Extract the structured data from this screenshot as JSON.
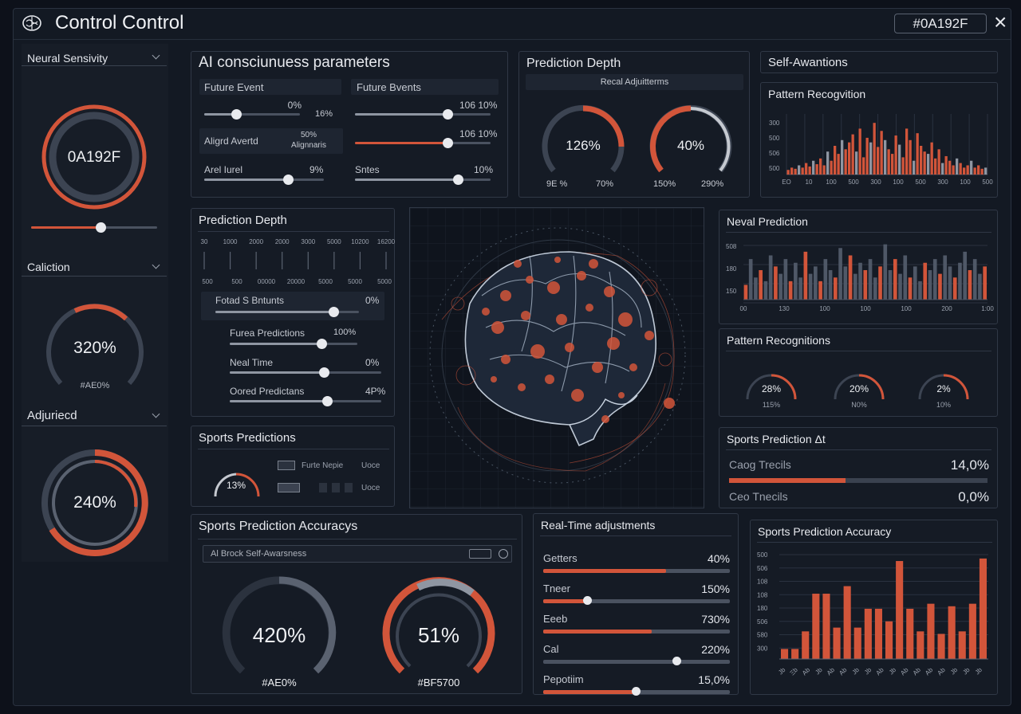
{
  "window": {
    "title": "Control Control",
    "id_badge": "#0A192F",
    "close_label": "×"
  },
  "colors": {
    "accent": "#d2553a",
    "panel": "#151b25",
    "track": "#4a5260"
  },
  "left": {
    "neural": {
      "title": "Neural Sensivity",
      "center": "0A192F",
      "ring": 0.75,
      "slider": 0.5
    },
    "calib": {
      "title": "Caliction",
      "value": "320%",
      "sub": "#AE0%",
      "arc": 0.3
    },
    "adjusted": {
      "title": "Adjuriecd",
      "value": "240%",
      "arc": 0.6
    }
  },
  "consc": {
    "title": "AI consciunuess parameters",
    "head_left": "Future Event",
    "head_right": "Future Bvents",
    "left": [
      {
        "label": "",
        "value": "0%",
        "slider": 0.3
      },
      {
        "label": "",
        "value": "16%",
        "slider": null
      },
      {
        "label": "Aligrd Avertd",
        "value": "50%\nAlignnaris",
        "slider": null
      },
      {
        "label": "Arel Iurel",
        "value": "9%",
        "slider": 0.73
      }
    ],
    "right": [
      {
        "label": "",
        "value": "106 10%",
        "slider": 0.68
      },
      {
        "label": "",
        "value": "106 10%",
        "slider": 0.68
      },
      {
        "label": "Sntes",
        "value": "10%",
        "slider": 0.7
      }
    ]
  },
  "pdepth_top": {
    "title": "Prediction Depth",
    "sub": "Recal Adjuitterms",
    "g1": {
      "value": "126%",
      "lo": "9E %",
      "hi": "70%",
      "arc": 0.55
    },
    "g2": {
      "value": "40%",
      "lo": "150%",
      "hi": "290%",
      "arc": 0.5
    }
  },
  "self": {
    "title": "Self-Awantions"
  },
  "pattern": {
    "title": "Pattern Recogvition",
    "y": [
      "300",
      "500",
      "506",
      "500"
    ],
    "x": [
      "ΕΟ",
      "10",
      "100",
      "500",
      "300",
      "100",
      "500",
      "300",
      "100",
      "500"
    ]
  },
  "pdepth_mid": {
    "title": "Prediction Depth",
    "top_ticks": [
      "30",
      "1000",
      "2000",
      "2000",
      "3000",
      "5000",
      "10200",
      "16200"
    ],
    "bot_ticks": [
      "500",
      "500",
      "00000",
      "20000",
      "5000",
      "5000",
      "5000"
    ],
    "rows": [
      {
        "label": "Fotad S Bntunts",
        "value": "0%",
        "slider": 0.72
      },
      {
        "label": "Furea Predictions",
        "value": "100%",
        "slider": 0.7
      },
      {
        "label": "Neal Time",
        "value": "0%",
        "slider": 0.75
      },
      {
        "label": "Oored Predictans",
        "value": "4P%",
        "slider": 0.8
      }
    ]
  },
  "sports_pred": {
    "title": "Sports Predictions",
    "gauge": "13%",
    "arc": 0.75,
    "items": [
      {
        "label": "Furte Nepie",
        "right": "Uoce"
      },
      {
        "label": "",
        "right": "Uoce"
      }
    ]
  },
  "neural_pred": {
    "title": "Neval Prediction",
    "y": [
      "508",
      "180",
      "150"
    ],
    "x": [
      "00",
      "130",
      "100",
      "100",
      "100",
      "200",
      "1:00"
    ]
  },
  "pattern2": {
    "title": "Pattern Recognitions",
    "g": [
      {
        "value": "28%",
        "sub": "115%",
        "arc": 0.45
      },
      {
        "value": "20%",
        "sub": "N0%",
        "arc": 0.4
      },
      {
        "value": "2%",
        "sub": "10%",
        "arc": 0.35
      }
    ]
  },
  "sports_pred_at": {
    "title": "Sports Prediction Δt",
    "rows": [
      {
        "label": "Caog Trecils",
        "value": "14,0%",
        "bar": 0.44
      },
      {
        "label": "Ceo Tnecils",
        "value": "0,0%",
        "bar": 0
      }
    ]
  },
  "accuracy_left": {
    "title": "Sports Prediction Accuracys",
    "search": "Al Brock Self-Awarsness",
    "g1": {
      "value": "420%",
      "sub": "#AE0%",
      "arc": 0.8
    },
    "g2": {
      "value": "51%",
      "sub": "#BF5700",
      "arc": 0.85
    }
  },
  "realtime": {
    "title": "Real-Time adjustments",
    "rows": [
      {
        "label": "Getters",
        "value": "40%",
        "bar": 0.66,
        "knob": null
      },
      {
        "label": "Tneer",
        "value": "150%",
        "bar": 0.24,
        "knob": 0.24
      },
      {
        "label": "Eeeb",
        "value": "730%",
        "bar": 0.58,
        "knob": null
      },
      {
        "label": "Cal",
        "value": "220%",
        "bar": 0.0,
        "knob": 0.72
      },
      {
        "label": "Pepotiim",
        "value": "15,0%",
        "bar": 0.5,
        "knob": 0.5
      }
    ]
  },
  "accuracy_right": {
    "title": "Sports Prediction Accuracy",
    "y": [
      "500",
      "506",
      "108",
      "108",
      "180",
      "506",
      "580",
      "300"
    ],
    "x": [
      "Jb",
      "Ξb",
      "Ab",
      "Jb",
      "Ab",
      "Ab",
      "Jb",
      "Jb",
      "Ab",
      "Jb",
      "Ab",
      "Ab",
      "Ab",
      "Ab",
      "Jb",
      "Jb",
      "Jb"
    ]
  },
  "chart_data": [
    {
      "type": "bar",
      "title": "Sports Prediction Accuracy",
      "categories": [
        "1",
        "2",
        "3",
        "4",
        "5",
        "6",
        "7",
        "8",
        "9",
        "10",
        "11",
        "12",
        "13",
        "14",
        "15",
        "16",
        "17"
      ],
      "values": [
        8,
        8,
        22,
        52,
        52,
        25,
        58,
        25,
        40,
        40,
        30,
        78,
        40,
        22,
        44,
        20,
        42,
        22,
        44,
        80
      ]
    },
    {
      "type": "bar",
      "title": "Pattern Recogvition",
      "values": [
        4,
        6,
        5,
        8,
        6,
        10,
        7,
        12,
        9,
        14,
        8,
        20,
        12,
        25,
        18,
        30,
        22,
        28,
        35,
        20,
        40,
        15,
        32,
        28,
        45,
        24,
        38,
        30,
        22,
        18,
        34,
        26,
        15,
        40,
        30,
        12,
        36,
        25,
        20,
        18,
        28,
        14,
        22,
        10,
        16,
        12,
        8,
        14,
        10,
        6,
        8,
        12,
        6,
        8,
        5,
        6
      ]
    },
    {
      "type": "bar",
      "title": "Neval Prediction",
      "values": [
        20,
        55,
        30,
        40,
        25,
        60,
        45,
        35,
        55,
        25,
        50,
        30,
        65,
        35,
        45,
        25,
        55,
        40,
        30,
        70,
        45,
        60,
        35,
        50,
        40,
        55,
        30,
        45,
        75,
        40,
        55,
        35,
        60,
        30,
        45,
        25,
        50,
        40,
        55,
        35,
        60,
        45,
        30,
        50,
        65,
        40,
        55,
        35,
        45
      ]
    }
  ]
}
